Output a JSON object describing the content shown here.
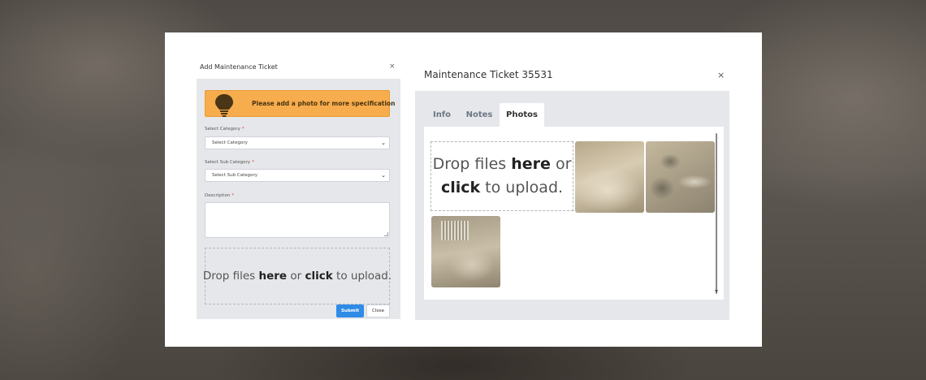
{
  "add_ticket": {
    "title": "Add Maintenance Ticket",
    "close_glyph": "×",
    "tip": {
      "icon": "lightbulb-icon",
      "text": "Please add a photo for more specification",
      "color": "#f7ac4d"
    },
    "category": {
      "label": "Select Category",
      "required_mark": "*",
      "value": "Select Category"
    },
    "sub_category": {
      "label": "Select Sub Category",
      "required_mark": "*",
      "value": "Select Sub Category"
    },
    "description": {
      "label": "Description",
      "required_mark": "*",
      "value": ""
    },
    "dropzone": {
      "prefix": "Drop files ",
      "here": "here",
      "middle": " or ",
      "click": "click",
      "suffix": " to upload."
    },
    "submit_label": "Submit",
    "close_label": "Close",
    "submit_color": "#2f8be6"
  },
  "ticket": {
    "title": "Maintenance Ticket 35531",
    "close_glyph": "×",
    "tabs": [
      {
        "label": "Info",
        "active": false
      },
      {
        "label": "Notes",
        "active": false
      },
      {
        "label": "Photos",
        "active": true
      }
    ],
    "dropzone": {
      "line1_prefix": "Drop files ",
      "here": "here",
      "line1_suffix": " or",
      "click": "click",
      "line2_suffix": " to upload."
    },
    "photos": [
      {
        "name": "ceiling-photo-1"
      },
      {
        "name": "ceiling-photo-2"
      },
      {
        "name": "ceiling-vent-photo"
      }
    ]
  }
}
